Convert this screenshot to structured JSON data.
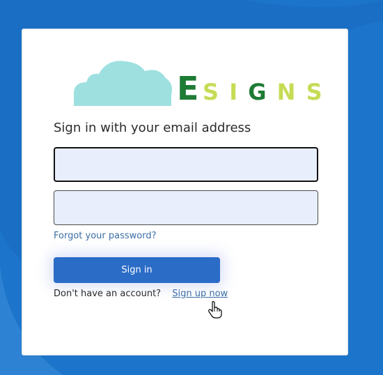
{
  "logo": {
    "first_letter": "E",
    "rest": [
      "S",
      "I",
      "G",
      "N",
      "S"
    ],
    "rest_colors": [
      "#c5dc55",
      "#c5dc55",
      "#1e7b35",
      "#c5dc55",
      "#c5dc55"
    ],
    "cloud_color": "#9ee0e0",
    "green": "#1e7b35",
    "lime": "#c5dc55"
  },
  "form": {
    "heading": "Sign in with your email address",
    "email_value": "",
    "password_value": "",
    "forgot_password": "Forgot your password?",
    "signin_label": "Sign in",
    "no_account_text": "Don't have an account?",
    "signup_label": "Sign up now"
  },
  "colors": {
    "background": "#1a6fc4",
    "button": "#2b6cc7",
    "link": "#3a6ea5",
    "field_bg": "#e8eefc"
  },
  "icons": {
    "cursor": "hand-pointer-icon"
  }
}
